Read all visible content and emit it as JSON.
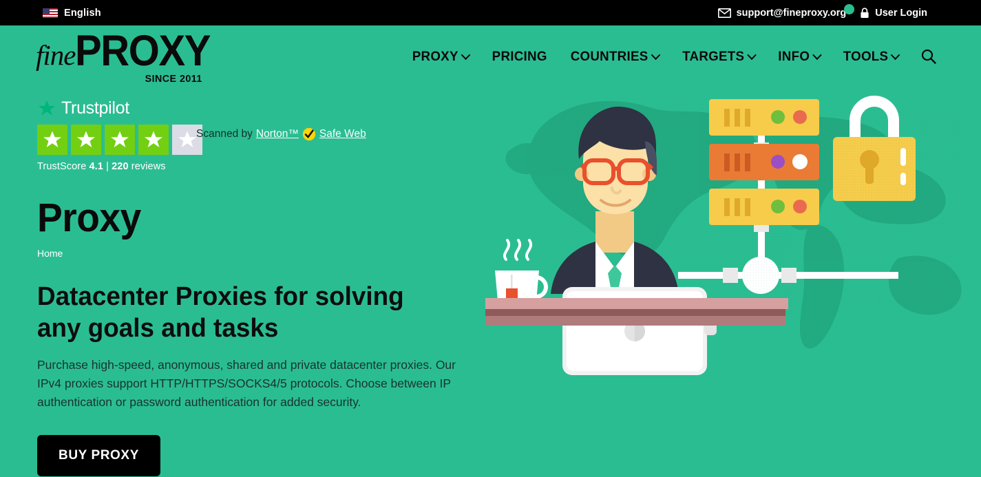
{
  "topbar": {
    "language": "English",
    "flag_icon": "us-flag-icon",
    "email": "support@fineproxy.org",
    "email_icon": "envelope-icon",
    "login_label": "User Login",
    "login_icon": "lock-icon",
    "badge_color": "#2bbd92",
    "background": "#000000"
  },
  "header": {
    "logo": {
      "fine": "fine",
      "proxy": "PROXY",
      "since": "SINCE 2011"
    },
    "nav": [
      {
        "label": "PROXY",
        "has_dropdown": true
      },
      {
        "label": "PRICING",
        "has_dropdown": false
      },
      {
        "label": "COUNTRIES",
        "has_dropdown": true
      },
      {
        "label": "TARGETS",
        "has_dropdown": true
      },
      {
        "label": "INFO",
        "has_dropdown": true
      },
      {
        "label": "TOOLS",
        "has_dropdown": true
      }
    ],
    "search_icon": "search-icon",
    "background": "#2bbd92"
  },
  "trustpilot": {
    "brand": "Trustpilot",
    "logo_icon": "trustpilot-star-icon",
    "stars_filled": 4,
    "stars_total": 5,
    "star_on_color": "#73cf11",
    "star_off_color": "#dcdce6",
    "score_prefix": "TrustScore",
    "score": "4.1",
    "separator": "|",
    "reviews_count": "220",
    "reviews_label": "reviews"
  },
  "norton": {
    "prefix": "Scanned by",
    "brand": "Norton™",
    "check_icon": "norton-check-icon",
    "suffix": "Safe Web"
  },
  "hero": {
    "title": "Proxy",
    "breadcrumb": "Home",
    "heading": "Datacenter Proxies for solving any goals and tasks",
    "paragraph": "Purchase high-speed, anonymous, shared and private datacenter proxies. Our IPv4 proxies support HTTP/HTTPS/SOCKS4/5 protocols. Choose between IP authentication or password authentication for added security.",
    "cta_label": "BUY PROXY"
  },
  "illustration": {
    "name": "datacenter-proxy-illustration",
    "elements": [
      "world-map-silhouette",
      "man-with-glasses",
      "laptop",
      "tea-cup",
      "desk",
      "server-rack-top",
      "server-rack-middle",
      "server-rack-bottom",
      "padlock",
      "network-connector"
    ],
    "colors": {
      "map": "#22a87f",
      "server_yellow": "#f7cc4a",
      "server_orange": "#ea7b35",
      "padlock_body": "#f7cc4a",
      "skin": "#fbe0a8",
      "hair": "#2f3242",
      "glasses": "#e8502e",
      "desk_top": "#d6a0a0",
      "desk_shadow": "#8f5a5a",
      "laptop": "#ffffff"
    }
  }
}
